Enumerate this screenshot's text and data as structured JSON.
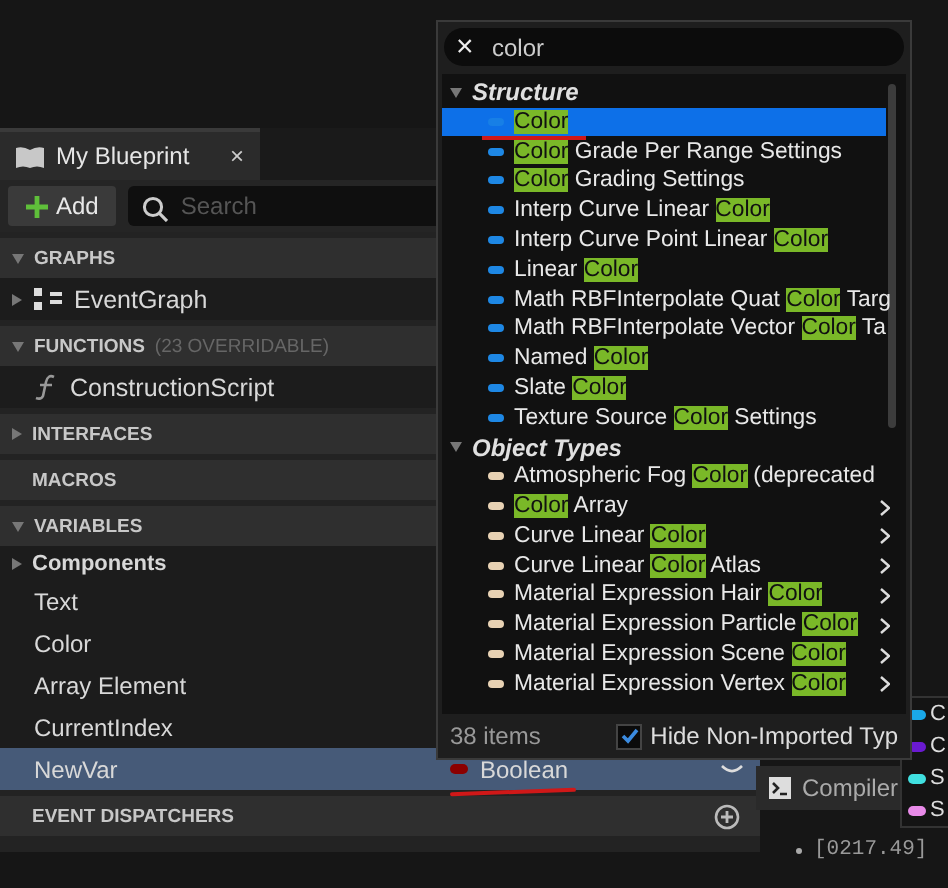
{
  "panel": {
    "tab": {
      "title": "My Blueprint",
      "close": "×"
    },
    "add_button": "Add",
    "search": {
      "placeholder": "Search"
    },
    "sections": [
      {
        "kind": "header",
        "label": "GRAPHS",
        "expanded": true
      },
      {
        "kind": "graph",
        "label": "EventGraph",
        "expandable": true
      },
      {
        "kind": "header",
        "label": "FUNCTIONS",
        "note": "(23 OVERRIDABLE)",
        "expanded": true
      },
      {
        "kind": "function",
        "label": "ConstructionScript",
        "expandable": false
      },
      {
        "kind": "header",
        "label": "INTERFACES",
        "expanded": false
      },
      {
        "kind": "header",
        "label": "MACROS"
      },
      {
        "kind": "header",
        "label": "VARIABLES",
        "expanded": true
      },
      {
        "kind": "group",
        "label": "Components",
        "expanded": false
      },
      {
        "kind": "var",
        "label": "Text",
        "selected": false
      },
      {
        "kind": "var",
        "label": "Color",
        "selected": false
      },
      {
        "kind": "var",
        "label": "Array Element",
        "selected": false
      },
      {
        "kind": "var",
        "label": "CurrentIndex",
        "selected": false
      },
      {
        "kind": "var",
        "label": "NewVar",
        "selected": true,
        "type": "Boolean",
        "underlined": true
      },
      {
        "kind": "header",
        "label": "EVENT DISPATCHERS",
        "add": true
      }
    ]
  },
  "type_picker": {
    "search": {
      "value": "color",
      "clear": "×"
    },
    "categories": [
      {
        "label": "Structure",
        "expanded": true,
        "color": "#1e88e5",
        "items": [
          {
            "segments": [
              {
                "text": "Color",
                "match": true
              }
            ],
            "selected": true,
            "underlined": true
          },
          {
            "segments": [
              {
                "text": "Color",
                "match": true
              },
              {
                "text": " Grade Per Range Settings",
                "match": false
              }
            ],
            "selected": false
          },
          {
            "segments": [
              {
                "text": "Color",
                "match": true
              },
              {
                "text": " Grading Settings",
                "match": false
              }
            ],
            "selected": false
          },
          {
            "segments": [
              {
                "text": "Interp Curve Linear ",
                "match": false
              },
              {
                "text": "Color",
                "match": true
              }
            ],
            "selected": false
          },
          {
            "segments": [
              {
                "text": "Interp Curve Point Linear ",
                "match": false
              },
              {
                "text": "Color",
                "match": true
              }
            ],
            "selected": false
          },
          {
            "segments": [
              {
                "text": "Linear ",
                "match": false
              },
              {
                "text": "Color",
                "match": true
              }
            ],
            "selected": false
          },
          {
            "segments": [
              {
                "text": "Math RBFInterpolate Quat ",
                "match": false
              },
              {
                "text": "Color",
                "match": true
              },
              {
                "text": " Targ",
                "match": false
              }
            ],
            "selected": false
          },
          {
            "segments": [
              {
                "text": "Math RBFInterpolate Vector ",
                "match": false
              },
              {
                "text": "Color",
                "match": true
              },
              {
                "text": " Ta",
                "match": false
              }
            ],
            "selected": false
          },
          {
            "segments": [
              {
                "text": "Named ",
                "match": false
              },
              {
                "text": "Color",
                "match": true
              }
            ],
            "selected": false
          },
          {
            "segments": [
              {
                "text": "Slate ",
                "match": false
              },
              {
                "text": "Color",
                "match": true
              }
            ],
            "selected": false
          },
          {
            "segments": [
              {
                "text": "Texture Source ",
                "match": false
              },
              {
                "text": "Color",
                "match": true
              },
              {
                "text": " Settings",
                "match": false
              }
            ],
            "selected": false
          }
        ]
      },
      {
        "label": "Object Types",
        "expanded": true,
        "color": "#e8d2b4",
        "items": [
          {
            "segments": [
              {
                "text": "Atmospheric Fog ",
                "match": false
              },
              {
                "text": "Color",
                "match": true
              },
              {
                "text": " (deprecated",
                "match": false
              }
            ],
            "selected": false
          },
          {
            "segments": [
              {
                "text": "Color",
                "match": true
              },
              {
                "text": " Array",
                "match": false
              }
            ],
            "selected": false,
            "submenu": true
          },
          {
            "segments": [
              {
                "text": "Curve Linear ",
                "match": false
              },
              {
                "text": "Color",
                "match": true
              }
            ],
            "selected": false,
            "submenu": true
          },
          {
            "segments": [
              {
                "text": "Curve Linear ",
                "match": false
              },
              {
                "text": "Color",
                "match": true
              },
              {
                "text": " Atlas",
                "match": false
              }
            ],
            "selected": false,
            "submenu": true
          },
          {
            "segments": [
              {
                "text": "Material Expression Hair ",
                "match": false
              },
              {
                "text": "Color",
                "match": true
              }
            ],
            "selected": false,
            "submenu": true
          },
          {
            "segments": [
              {
                "text": "Material Expression Particle ",
                "match": false
              },
              {
                "text": "Color",
                "match": true
              }
            ],
            "selected": false,
            "submenu": true
          },
          {
            "segments": [
              {
                "text": "Material Expression Scene ",
                "match": false
              },
              {
                "text": "Color",
                "match": true
              }
            ],
            "selected": false,
            "submenu": true
          },
          {
            "segments": [
              {
                "text": "Material Expression Vertex ",
                "match": false
              },
              {
                "text": "Color",
                "match": true
              }
            ],
            "selected": false,
            "submenu": true
          }
        ]
      }
    ],
    "count": "38 items",
    "hide_non_imported": {
      "label": "Hide Non-Imported Typ",
      "checked": true
    }
  },
  "container_menu": {
    "items": [
      {
        "label": "C",
        "color": "#1aa8e8"
      },
      {
        "label": "C",
        "color": "#6a1ad0"
      },
      {
        "label": "S",
        "color": "#40e0e0"
      },
      {
        "label": "S",
        "color": "#e88ae8"
      }
    ]
  },
  "compiler_tab": {
    "title": "Compiler"
  },
  "log": {
    "lines": [
      "[0217.49]"
    ]
  }
}
